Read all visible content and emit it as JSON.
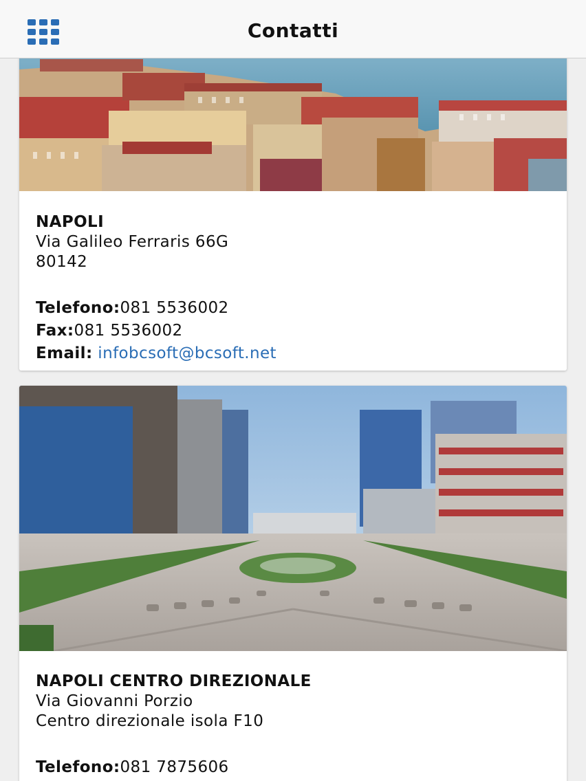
{
  "header": {
    "title": "Contatti",
    "menu_icon": "grid-menu-icon"
  },
  "colors": {
    "accent": "#2a6db5",
    "background": "#efefef",
    "card": "#ffffff"
  },
  "offices": [
    {
      "name": "NAPOLI",
      "address_line_1": "Via Galileo Ferraris 66G",
      "address_line_2": "80142",
      "phone_label": "Telefono:",
      "phone": "081 5536002",
      "fax_label": "Fax:",
      "fax": "081 5536002",
      "email_label": "Email:",
      "email": "infobcsoft@bcsoft.net",
      "photo_icon": "naples-seafront-photo"
    },
    {
      "name": "NAPOLI CENTRO DIREZIONALE",
      "address_line_1": "Via Giovanni Porzio",
      "address_line_2": "Centro direzionale isola F10",
      "phone_label": "Telefono:",
      "phone": "081 7875606",
      "photo_icon": "business-district-photo"
    }
  ]
}
